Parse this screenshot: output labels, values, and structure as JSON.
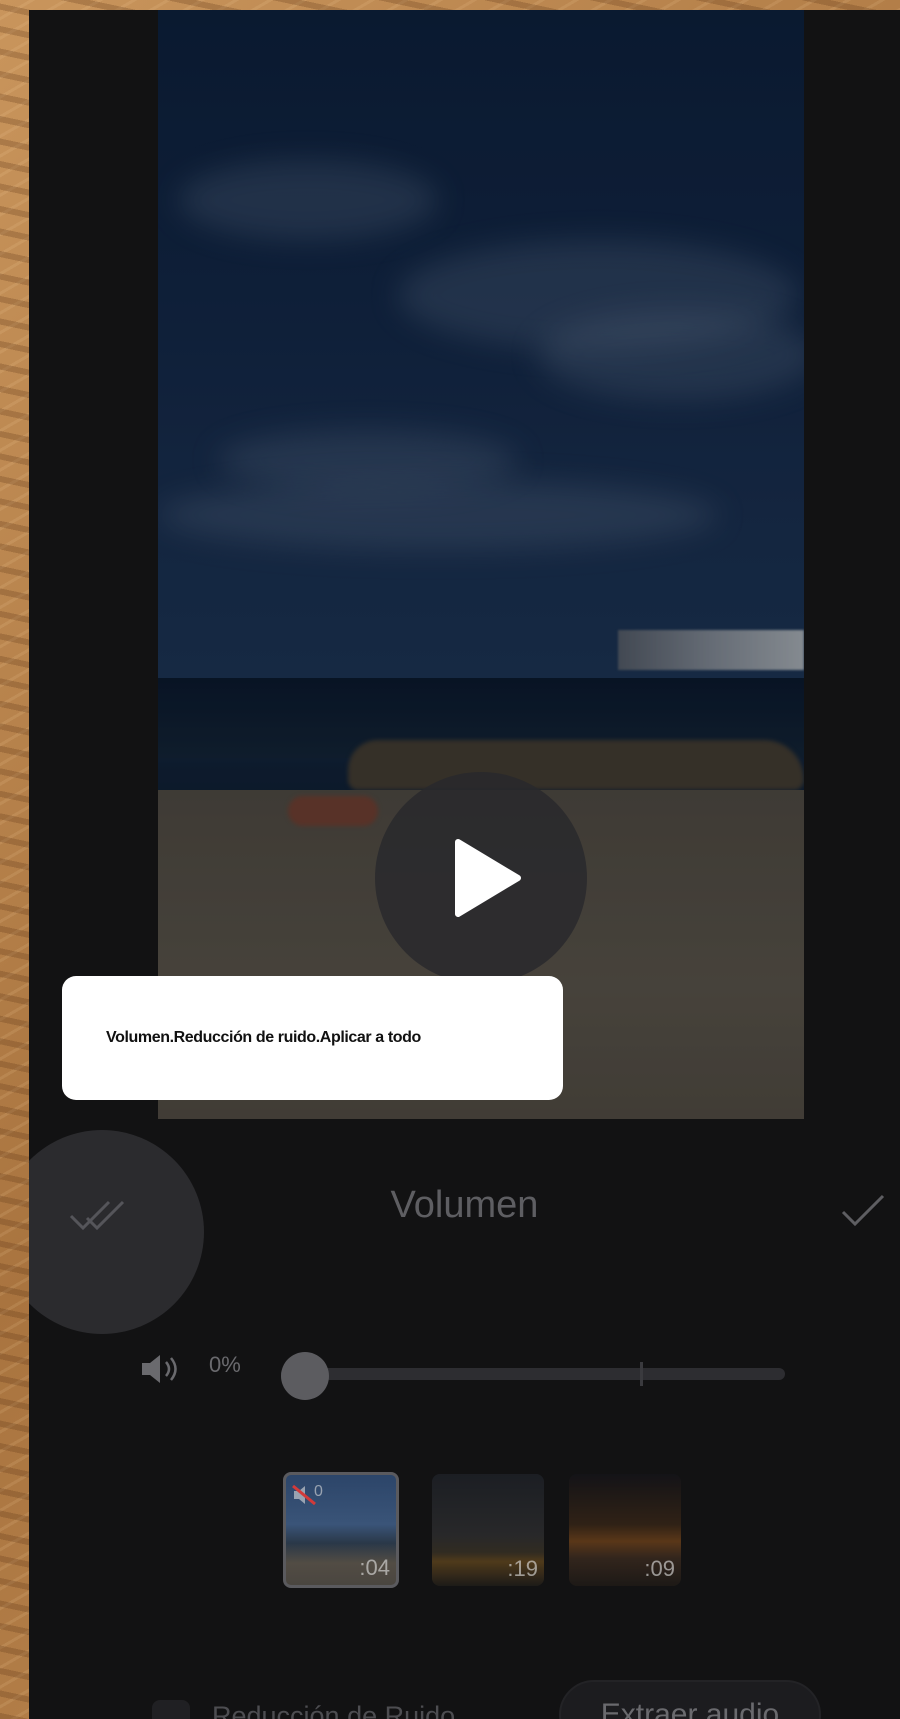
{
  "tooltip": {
    "text": "Volumen.Reducción de ruido.Aplicar a todo"
  },
  "panel": {
    "title": "Volumen",
    "apply_all_icon": "double-check-icon",
    "confirm_icon": "check-icon"
  },
  "volume": {
    "icon": "speaker-icon",
    "value_label": "0%",
    "level": 0
  },
  "clips": [
    {
      "duration": ":04",
      "selected": true,
      "muted": true,
      "mute_label": "0"
    },
    {
      "duration": ":19",
      "selected": false
    },
    {
      "duration": ":09",
      "selected": false
    }
  ],
  "noise_reduction": {
    "label": "Reducción de Ruido",
    "checked": false
  },
  "extract_audio": {
    "label": "Extraer audio"
  },
  "colors": {
    "screen_bg": "#121213",
    "tooltip_bg": "#ffffff",
    "frame": "#b8874f"
  }
}
